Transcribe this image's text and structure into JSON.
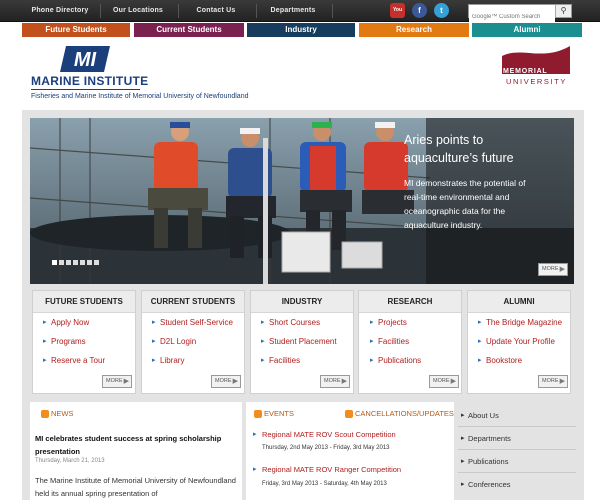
{
  "utility_nav": [
    "Phone Directory",
    "Our Locations",
    "Contact Us",
    "Departments"
  ],
  "social": {
    "youtube": {
      "icon": "youtube-icon",
      "glyph": "You",
      "color": "#c4302b"
    },
    "facebook": {
      "icon": "facebook-icon",
      "glyph": "f",
      "color": "#3b5998"
    },
    "twitter": {
      "icon": "twitter-icon",
      "glyph": "t",
      "color": "#33a0d8"
    }
  },
  "search": {
    "placeholder": "Google™ Custom Search",
    "icon": "search-icon",
    "glyph": "⚲"
  },
  "audience_tabs": [
    {
      "label": "Future Students",
      "color": "#c2501d"
    },
    {
      "label": "Current Students",
      "color": "#7a2150"
    },
    {
      "label": "Industry",
      "color": "#163d5e"
    },
    {
      "label": "Research",
      "color": "#e27a13"
    },
    {
      "label": "Alumni",
      "color": "#1b8f8f"
    }
  ],
  "header": {
    "logo_text": "MI",
    "name": "MARINE INSTITUTE",
    "subtitle": "Fisheries and Marine Institute of Memorial University of Newfoundland",
    "mun_line1": "MEMORIAL",
    "mun_line2": "UNIVERSITY",
    "brand_blue": "#1b3f7a",
    "mun_red": "#8e1b2e"
  },
  "hero": {
    "title": "Aries points to aquaculture’s future",
    "text": "MI demonstrates the potential of real-time environmental and oceanographic data for the aquaculture industry.",
    "more": "MORE",
    "more_icon": "arrow-right-icon"
  },
  "boxes": [
    {
      "title": "FUTURE STUDENTS",
      "links": [
        "Apply Now",
        "Programs",
        "Reserve a Tour"
      ],
      "more": "MORE"
    },
    {
      "title": "CURRENT STUDENTS",
      "links": [
        "Student Self-Service",
        "D2L Login",
        "Library"
      ],
      "more": "MORE"
    },
    {
      "title": "INDUSTRY",
      "links": [
        "Short Courses",
        "Student Placement",
        "Facilities"
      ],
      "more": "MORE"
    },
    {
      "title": "RESEARCH",
      "links": [
        "Projects",
        "Facilities",
        "Publications"
      ],
      "more": "MORE"
    },
    {
      "title": "ALUMNI",
      "links": [
        "The Bridge Magazine",
        "Update Your Profile",
        "Bookstore"
      ],
      "more": "MORE"
    }
  ],
  "news": {
    "heading": "NEWS",
    "title": "MI celebrates student success at spring scholarship presentation",
    "date": "Thursday, March 21, 2013",
    "body": "The Marine Institute of Memorial University of Newfoundland held its annual spring presentation of"
  },
  "events": {
    "heading": "EVENTS",
    "cancellations_heading": "CANCELLATIONS/UPDATES",
    "items": [
      {
        "title": "Regional MATE ROV Scout Competition",
        "date": "Thursday, 2nd May 2013 - Friday, 3rd May 2013"
      },
      {
        "title": "Regional MATE ROV Ranger Competition",
        "date": "Friday, 3rd May 2013 - Saturday, 4th May 2013"
      }
    ]
  },
  "sidebar": [
    "About Us",
    "Departments",
    "Publications",
    "Conferences"
  ]
}
